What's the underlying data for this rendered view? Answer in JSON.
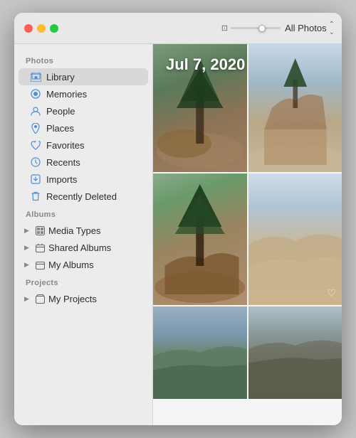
{
  "window": {
    "title": "Photos"
  },
  "titlebar": {
    "slider_label": "zoom slider",
    "all_photos_label": "All Photos",
    "chevron": "⌃⌄"
  },
  "sidebar": {
    "section_photos": "Photos",
    "section_albums": "Albums",
    "section_projects": "Projects",
    "items_photos": [
      {
        "id": "library",
        "label": "Library",
        "icon": "🖼",
        "active": true
      },
      {
        "id": "memories",
        "label": "Memories",
        "icon": "⊕"
      },
      {
        "id": "people",
        "label": "People",
        "icon": "👤"
      },
      {
        "id": "places",
        "label": "Places",
        "icon": "📍"
      },
      {
        "id": "favorites",
        "label": "Favorites",
        "icon": "♡"
      },
      {
        "id": "recents",
        "label": "Recents",
        "icon": "🕐"
      },
      {
        "id": "imports",
        "label": "Imports",
        "icon": "⬇"
      },
      {
        "id": "recently-deleted",
        "label": "Recently Deleted",
        "icon": "🗑"
      }
    ],
    "items_albums": [
      {
        "id": "media-types",
        "label": "Media Types"
      },
      {
        "id": "shared-albums",
        "label": "Shared Albums"
      },
      {
        "id": "my-albums",
        "label": "My Albums"
      }
    ],
    "items_projects": [
      {
        "id": "my-projects",
        "label": "My Projects"
      }
    ]
  },
  "photo_area": {
    "date_label": "Jul 7, 2020"
  }
}
